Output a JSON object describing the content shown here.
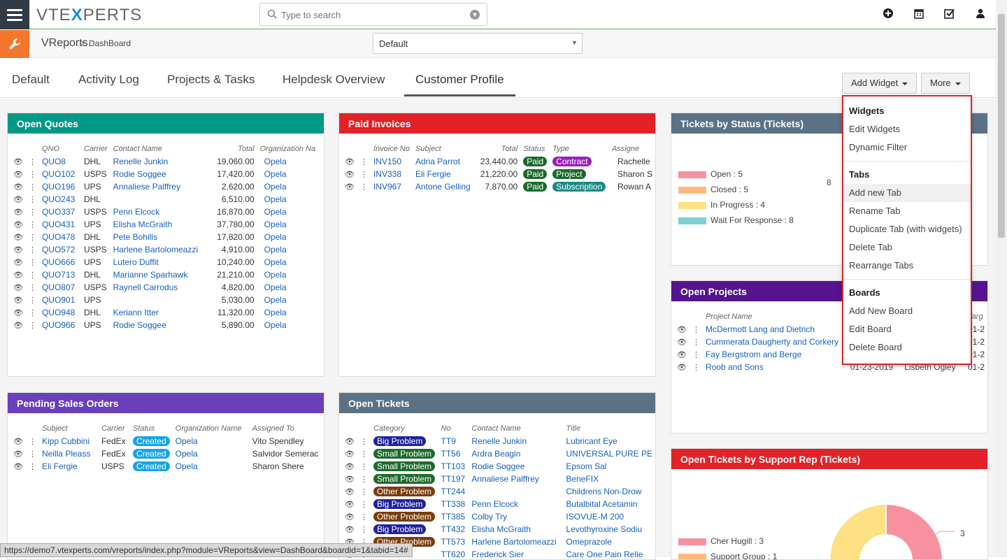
{
  "app": {
    "logo_left": "VTE",
    "logo_x": "X",
    "logo_right": "PERTS"
  },
  "search": {
    "placeholder": "Type to search"
  },
  "breadcrumb": {
    "module": "VReports",
    "page": "DashBoard"
  },
  "board_select": {
    "value": "Default"
  },
  "tabs": [
    "Default",
    "Activity Log",
    "Projects & Tasks",
    "Helpdesk Overview",
    "Customer Profile"
  ],
  "buttons": {
    "add_widget": "Add Widget",
    "more": "More"
  },
  "dropdown": {
    "widgets_header": "Widgets",
    "edit_widgets": "Edit Widgets",
    "dynamic_filter": "Dynamic Filter",
    "tabs_header": "Tabs",
    "add_new_tab": "Add new Tab",
    "rename_tab": "Rename Tab",
    "duplicate_tab": "Duplicate Tab (with widgets)",
    "delete_tab": "Delete Tab",
    "rearrange_tabs": "Rearrange Tabs",
    "boards_header": "Boards",
    "add_new_board": "Add New Board",
    "edit_board": "Edit Board",
    "delete_board": "Delete Board"
  },
  "open_quotes": {
    "title": "Open Quotes",
    "columns": [
      "QNO",
      "Carrier",
      "Contact Name",
      "Total",
      "Organization Na"
    ],
    "rows": [
      [
        "QUO8",
        "DHL",
        "Renelle Junkin",
        "19,060.00",
        "Opela"
      ],
      [
        "QUO102",
        "USPS",
        "Rodie Soggee",
        "17,420.00",
        "Opela"
      ],
      [
        "QUO196",
        "UPS",
        "Annaliese Palffrey",
        "2,620.00",
        "Opela"
      ],
      [
        "QUO243",
        "DHL",
        "",
        "6,510.00",
        "Opela"
      ],
      [
        "QUO337",
        "USPS",
        "Penn Elcock",
        "16,870.00",
        "Opela"
      ],
      [
        "QUO431",
        "UPS",
        "Elisha McGraith",
        "37,780.00",
        "Opela"
      ],
      [
        "QUO478",
        "DHL",
        "Pete Bohills",
        "17,820.00",
        "Opela"
      ],
      [
        "QUO572",
        "USPS",
        "Harlene Bartolomeazzi",
        "4,910.00",
        "Opela"
      ],
      [
        "QUO666",
        "UPS",
        "Lutero Duffit",
        "10,240.00",
        "Opela"
      ],
      [
        "QUO713",
        "DHL",
        "Marianne Sparhawk",
        "21,210.00",
        "Opela"
      ],
      [
        "QUO807",
        "USPS",
        "Raynell Carrodus",
        "4,820.00",
        "Opela"
      ],
      [
        "QUO901",
        "UPS",
        "",
        "5,030.00",
        "Opela"
      ],
      [
        "QUO948",
        "DHL",
        "Keriann Itter",
        "11,320.00",
        "Opela"
      ],
      [
        "QUO966",
        "UPS",
        "Rodie Soggee",
        "5,890.00",
        "Opela"
      ]
    ]
  },
  "paid_invoices": {
    "title": "Paid Invoices",
    "columns": [
      "Invoice No",
      "Subject",
      "Total",
      "Status",
      "Type",
      "Assigne"
    ],
    "rows": [
      [
        "INV150",
        "Adria Parrot",
        "23,440.00",
        "Paid",
        "Contract",
        "Rachelle"
      ],
      [
        "INV338",
        "Eli Fergie",
        "21,220.00",
        "Paid",
        "Project",
        "Sharon S"
      ],
      [
        "INV967",
        "Antone Gelling",
        "7,870.00",
        "Paid",
        "Subscription",
        "Rowan A"
      ]
    ]
  },
  "tickets_status": {
    "title": "Tickets by Status (Tickets)",
    "legend": [
      "Open : 5",
      "Closed : 5",
      "In Progress : 4",
      "Wait For Response : 8"
    ],
    "legend_colors": [
      "#f7909f",
      "#fdb97d",
      "#fde184",
      "#7fd1d1"
    ],
    "label": "8"
  },
  "open_projects": {
    "title": "Open Projects",
    "columns": [
      "Project Name",
      "Targ"
    ],
    "rows": [
      [
        "McDermott Lang and Dietrich",
        "01-2"
      ],
      [
        "Cummerata Daugherty and Corkery",
        "01-2"
      ],
      [
        "Fay Bergstrom and Berge",
        "01-2"
      ],
      [
        "Roob and Sons",
        "01-23-2019",
        "Lisbeth Ogley",
        "01-2"
      ]
    ]
  },
  "pending_orders": {
    "title": "Pending Sales Orders",
    "columns": [
      "Subject",
      "Carrier",
      "Status",
      "Organization Name",
      "Assigned To"
    ],
    "rows": [
      [
        "Kipp Cubbini",
        "FedEx",
        "Created",
        "Opela",
        "Vito Spendley"
      ],
      [
        "Neilla Pleass",
        "FedEx",
        "Created",
        "Opela",
        "Salvidor Semerac"
      ],
      [
        "Eli Fergie",
        "USPS",
        "Created",
        "Opela",
        "Sharon Shere"
      ]
    ]
  },
  "open_tickets": {
    "title": "Open Tickets",
    "columns": [
      "Category",
      "No",
      "Contact Name",
      "Title"
    ],
    "rows": [
      [
        "Big Problem",
        "TT9",
        "Renelle Junkin",
        "Lubricant Eye"
      ],
      [
        "Small Problem",
        "TT56",
        "Ardra Beagin",
        "UNIVERSAL PURE PE"
      ],
      [
        "Small Problem",
        "TT103",
        "Rodie Soggee",
        "Epsom Sal"
      ],
      [
        "Small Problem",
        "TT197",
        "Annaliese Palffrey",
        "BeneFIX"
      ],
      [
        "Other Problem",
        "TT244",
        "",
        "Childrens Non-Drow"
      ],
      [
        "Big Problem",
        "TT338",
        "Penn Elcock",
        "Butalbital Acetamin"
      ],
      [
        "Other Problem",
        "TT385",
        "Colby Try",
        "ISOVUE-M 200"
      ],
      [
        "Big Problem",
        "TT432",
        "Elisha McGraith",
        "Levothyroxine Sodiu"
      ],
      [
        "Other Problem",
        "TT573",
        "Harlene Bartolomeazzi",
        "Omeprazole"
      ],
      [
        "",
        "TT620",
        "Frederick Sier",
        "Care One Pain Relie"
      ]
    ],
    "category_colors": {
      "Big Problem": "#22229e",
      "Small Problem": "#1d6b2a",
      "Other Problem": "#7a3d0c"
    }
  },
  "tickets_rep": {
    "title": "Open Tickets by Support Rep (Tickets)",
    "legend": [
      "Cher Hugill : 3",
      "Support Group : 1"
    ],
    "legend_colors": [
      "#f7909f",
      "#fdb97d"
    ],
    "label": "3"
  },
  "status_url": "https://demo7.vtexperts.com/vreports/index.php?module=VReports&view=DashBoard&boardid=1&tabid=14#",
  "colors": {
    "teal": "#009a86",
    "red": "#e32128",
    "slate": "#5b7285",
    "purple_dark": "#55138f",
    "purple": "#6a3fbc",
    "accent_orange": "#f4772b",
    "paid": "#1b6a2b",
    "contract": "#9b1fbd",
    "project": "#1b6a2b",
    "subscription": "#1b8a84",
    "created": "#15a5e6"
  }
}
